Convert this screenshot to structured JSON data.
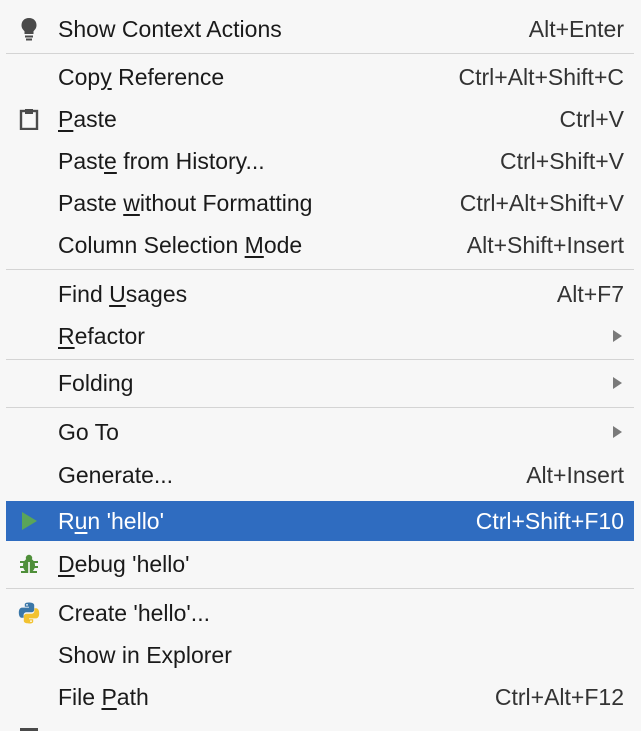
{
  "colors": {
    "background": "#f7f7f7",
    "selection": "#2f6cc0",
    "separator": "#d4d4d4",
    "submenu_arrow": "#7a7a7a",
    "run_icon": "#5aa55a",
    "debug_icon": "#4f8f3a",
    "python_blue": "#3b77a8",
    "python_yellow": "#f2c230"
  },
  "menu": {
    "show_context_actions": {
      "label": "Show Context Actions",
      "shortcut": "Alt+Enter",
      "icon": "lightbulb-icon"
    },
    "copy_reference": {
      "label_pre": "Cop",
      "label_mn": "y",
      "label_post": " Reference",
      "shortcut": "Ctrl+Alt+Shift+C"
    },
    "paste": {
      "label_pre": "",
      "label_mn": "P",
      "label_post": "aste",
      "shortcut": "Ctrl+V",
      "icon": "clipboard-icon"
    },
    "paste_from_history": {
      "label_pre": "Past",
      "label_mn": "e",
      "label_post": " from History...",
      "shortcut": "Ctrl+Shift+V"
    },
    "paste_without_formatting": {
      "label_pre": "Paste ",
      "label_mn": "w",
      "label_post": "ithout Formatting",
      "shortcut": "Ctrl+Alt+Shift+V"
    },
    "column_selection_mode": {
      "label_pre": "Column Selection ",
      "label_mn": "M",
      "label_post": "ode",
      "shortcut": "Alt+Shift+Insert"
    },
    "find_usages": {
      "label_pre": "Find ",
      "label_mn": "U",
      "label_post": "sages",
      "shortcut": "Alt+F7"
    },
    "refactor": {
      "label_pre": "",
      "label_mn": "R",
      "label_post": "efactor"
    },
    "folding": {
      "label": "Folding"
    },
    "go_to": {
      "label": "Go To"
    },
    "generate": {
      "label": "Generate...",
      "shortcut": "Alt+Insert"
    },
    "run": {
      "label_pre": "R",
      "label_mn": "u",
      "label_post": "n 'hello'",
      "shortcut": "Ctrl+Shift+F10",
      "icon": "run-icon",
      "selected": true
    },
    "debug": {
      "label_pre": "",
      "label_mn": "D",
      "label_post": "ebug 'hello'",
      "icon": "debug-bug-icon"
    },
    "create": {
      "label": "Create 'hello'...",
      "icon": "python-icon"
    },
    "show_in_explorer": {
      "label": "Show in Explorer"
    },
    "file_path": {
      "label_pre": "File ",
      "label_mn": "P",
      "label_post": "ath",
      "shortcut": "Ctrl+Alt+F12"
    }
  }
}
